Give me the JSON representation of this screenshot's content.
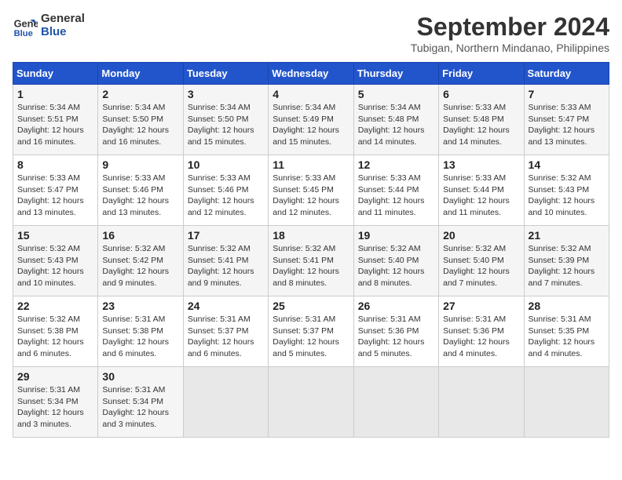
{
  "logo": {
    "line1": "General",
    "line2": "Blue"
  },
  "title": "September 2024",
  "location": "Tubigan, Northern Mindanao, Philippines",
  "weekdays": [
    "Sunday",
    "Monday",
    "Tuesday",
    "Wednesday",
    "Thursday",
    "Friday",
    "Saturday"
  ],
  "weeks": [
    [
      {
        "day": "1",
        "info": "Sunrise: 5:34 AM\nSunset: 5:51 PM\nDaylight: 12 hours\nand 16 minutes."
      },
      {
        "day": "2",
        "info": "Sunrise: 5:34 AM\nSunset: 5:50 PM\nDaylight: 12 hours\nand 16 minutes."
      },
      {
        "day": "3",
        "info": "Sunrise: 5:34 AM\nSunset: 5:50 PM\nDaylight: 12 hours\nand 15 minutes."
      },
      {
        "day": "4",
        "info": "Sunrise: 5:34 AM\nSunset: 5:49 PM\nDaylight: 12 hours\nand 15 minutes."
      },
      {
        "day": "5",
        "info": "Sunrise: 5:34 AM\nSunset: 5:48 PM\nDaylight: 12 hours\nand 14 minutes."
      },
      {
        "day": "6",
        "info": "Sunrise: 5:33 AM\nSunset: 5:48 PM\nDaylight: 12 hours\nand 14 minutes."
      },
      {
        "day": "7",
        "info": "Sunrise: 5:33 AM\nSunset: 5:47 PM\nDaylight: 12 hours\nand 13 minutes."
      }
    ],
    [
      {
        "day": "8",
        "info": "Sunrise: 5:33 AM\nSunset: 5:47 PM\nDaylight: 12 hours\nand 13 minutes."
      },
      {
        "day": "9",
        "info": "Sunrise: 5:33 AM\nSunset: 5:46 PM\nDaylight: 12 hours\nand 13 minutes."
      },
      {
        "day": "10",
        "info": "Sunrise: 5:33 AM\nSunset: 5:46 PM\nDaylight: 12 hours\nand 12 minutes."
      },
      {
        "day": "11",
        "info": "Sunrise: 5:33 AM\nSunset: 5:45 PM\nDaylight: 12 hours\nand 12 minutes."
      },
      {
        "day": "12",
        "info": "Sunrise: 5:33 AM\nSunset: 5:44 PM\nDaylight: 12 hours\nand 11 minutes."
      },
      {
        "day": "13",
        "info": "Sunrise: 5:33 AM\nSunset: 5:44 PM\nDaylight: 12 hours\nand 11 minutes."
      },
      {
        "day": "14",
        "info": "Sunrise: 5:32 AM\nSunset: 5:43 PM\nDaylight: 12 hours\nand 10 minutes."
      }
    ],
    [
      {
        "day": "15",
        "info": "Sunrise: 5:32 AM\nSunset: 5:43 PM\nDaylight: 12 hours\nand 10 minutes."
      },
      {
        "day": "16",
        "info": "Sunrise: 5:32 AM\nSunset: 5:42 PM\nDaylight: 12 hours\nand 9 minutes."
      },
      {
        "day": "17",
        "info": "Sunrise: 5:32 AM\nSunset: 5:41 PM\nDaylight: 12 hours\nand 9 minutes."
      },
      {
        "day": "18",
        "info": "Sunrise: 5:32 AM\nSunset: 5:41 PM\nDaylight: 12 hours\nand 8 minutes."
      },
      {
        "day": "19",
        "info": "Sunrise: 5:32 AM\nSunset: 5:40 PM\nDaylight: 12 hours\nand 8 minutes."
      },
      {
        "day": "20",
        "info": "Sunrise: 5:32 AM\nSunset: 5:40 PM\nDaylight: 12 hours\nand 7 minutes."
      },
      {
        "day": "21",
        "info": "Sunrise: 5:32 AM\nSunset: 5:39 PM\nDaylight: 12 hours\nand 7 minutes."
      }
    ],
    [
      {
        "day": "22",
        "info": "Sunrise: 5:32 AM\nSunset: 5:38 PM\nDaylight: 12 hours\nand 6 minutes."
      },
      {
        "day": "23",
        "info": "Sunrise: 5:31 AM\nSunset: 5:38 PM\nDaylight: 12 hours\nand 6 minutes."
      },
      {
        "day": "24",
        "info": "Sunrise: 5:31 AM\nSunset: 5:37 PM\nDaylight: 12 hours\nand 6 minutes."
      },
      {
        "day": "25",
        "info": "Sunrise: 5:31 AM\nSunset: 5:37 PM\nDaylight: 12 hours\nand 5 minutes."
      },
      {
        "day": "26",
        "info": "Sunrise: 5:31 AM\nSunset: 5:36 PM\nDaylight: 12 hours\nand 5 minutes."
      },
      {
        "day": "27",
        "info": "Sunrise: 5:31 AM\nSunset: 5:36 PM\nDaylight: 12 hours\nand 4 minutes."
      },
      {
        "day": "28",
        "info": "Sunrise: 5:31 AM\nSunset: 5:35 PM\nDaylight: 12 hours\nand 4 minutes."
      }
    ],
    [
      {
        "day": "29",
        "info": "Sunrise: 5:31 AM\nSunset: 5:34 PM\nDaylight: 12 hours\nand 3 minutes."
      },
      {
        "day": "30",
        "info": "Sunrise: 5:31 AM\nSunset: 5:34 PM\nDaylight: 12 hours\nand 3 minutes."
      },
      {
        "day": "",
        "info": ""
      },
      {
        "day": "",
        "info": ""
      },
      {
        "day": "",
        "info": ""
      },
      {
        "day": "",
        "info": ""
      },
      {
        "day": "",
        "info": ""
      }
    ]
  ]
}
